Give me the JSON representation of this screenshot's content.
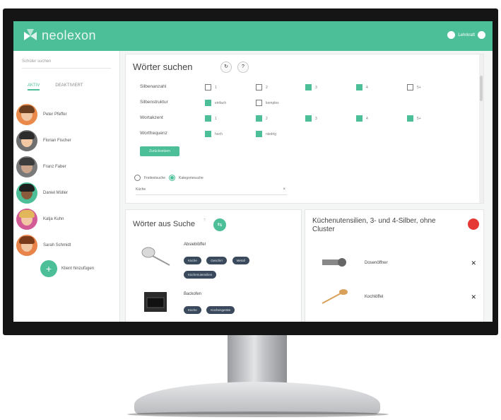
{
  "app": {
    "logo_text": "neolexon",
    "user_label": "Lehrkraft"
  },
  "sidebar": {
    "search_placeholder": "Schüler suchen",
    "tabs": [
      {
        "label": "AKTIV"
      },
      {
        "label": "DEAKTIVIERT"
      }
    ],
    "pupils": [
      {
        "name": "Peter Pfeffer"
      },
      {
        "name": "Florian Fischer"
      },
      {
        "name": "Franz Faber"
      },
      {
        "name": "Daniel Müller"
      },
      {
        "name": "Katja Kuhn"
      },
      {
        "name": "Sarah Schmidt"
      }
    ],
    "add_label": "Klient hinzufügen"
  },
  "search": {
    "title": "Wörter suchen",
    "rows": [
      {
        "label": "Silbenanzahl",
        "options": [
          {
            "t": "1",
            "on": false
          },
          {
            "t": "2",
            "on": false
          },
          {
            "t": "3",
            "on": true
          },
          {
            "t": "4",
            "on": true
          },
          {
            "t": "5+",
            "on": false
          }
        ]
      },
      {
        "label": "Silbenstruktur",
        "options": [
          {
            "t": "einfach",
            "on": true
          },
          {
            "t": "komplex",
            "on": false
          }
        ]
      },
      {
        "label": "Wortakzent",
        "options": [
          {
            "t": "1",
            "on": true
          },
          {
            "t": "2",
            "on": true
          },
          {
            "t": "3",
            "on": true
          },
          {
            "t": "4",
            "on": true
          },
          {
            "t": "5+",
            "on": true
          }
        ]
      },
      {
        "label": "Wortfrequenz",
        "options": [
          {
            "t": "hoch",
            "on": true
          },
          {
            "t": "niedrig",
            "on": true
          }
        ]
      }
    ],
    "reset_label": "Zurücksetzen",
    "radio_free": "Freitextsuche",
    "radio_cat": "Kategoriesuche",
    "select_value": "Küche"
  },
  "results": {
    "title": "Wörter aus Suche",
    "words": [
      {
        "name": "Absieblöffel",
        "chips": [
          "Küche",
          "Geschirr",
          "Metall",
          "Küchenutensilien"
        ]
      },
      {
        "name": "Backofen",
        "chips": [
          "Küche",
          "Küchengeräte"
        ]
      }
    ]
  },
  "list": {
    "title": "Küchenutensilien, 3- und 4-Silber, ohne Cluster",
    "items": [
      {
        "name": "Dosenöffner"
      },
      {
        "name": "Kochlöffel"
      }
    ],
    "close_glyph": "✕"
  },
  "colors": {
    "accent": "#4cbf98",
    "danger": "#e53935",
    "chip": "#3a4a5c"
  }
}
